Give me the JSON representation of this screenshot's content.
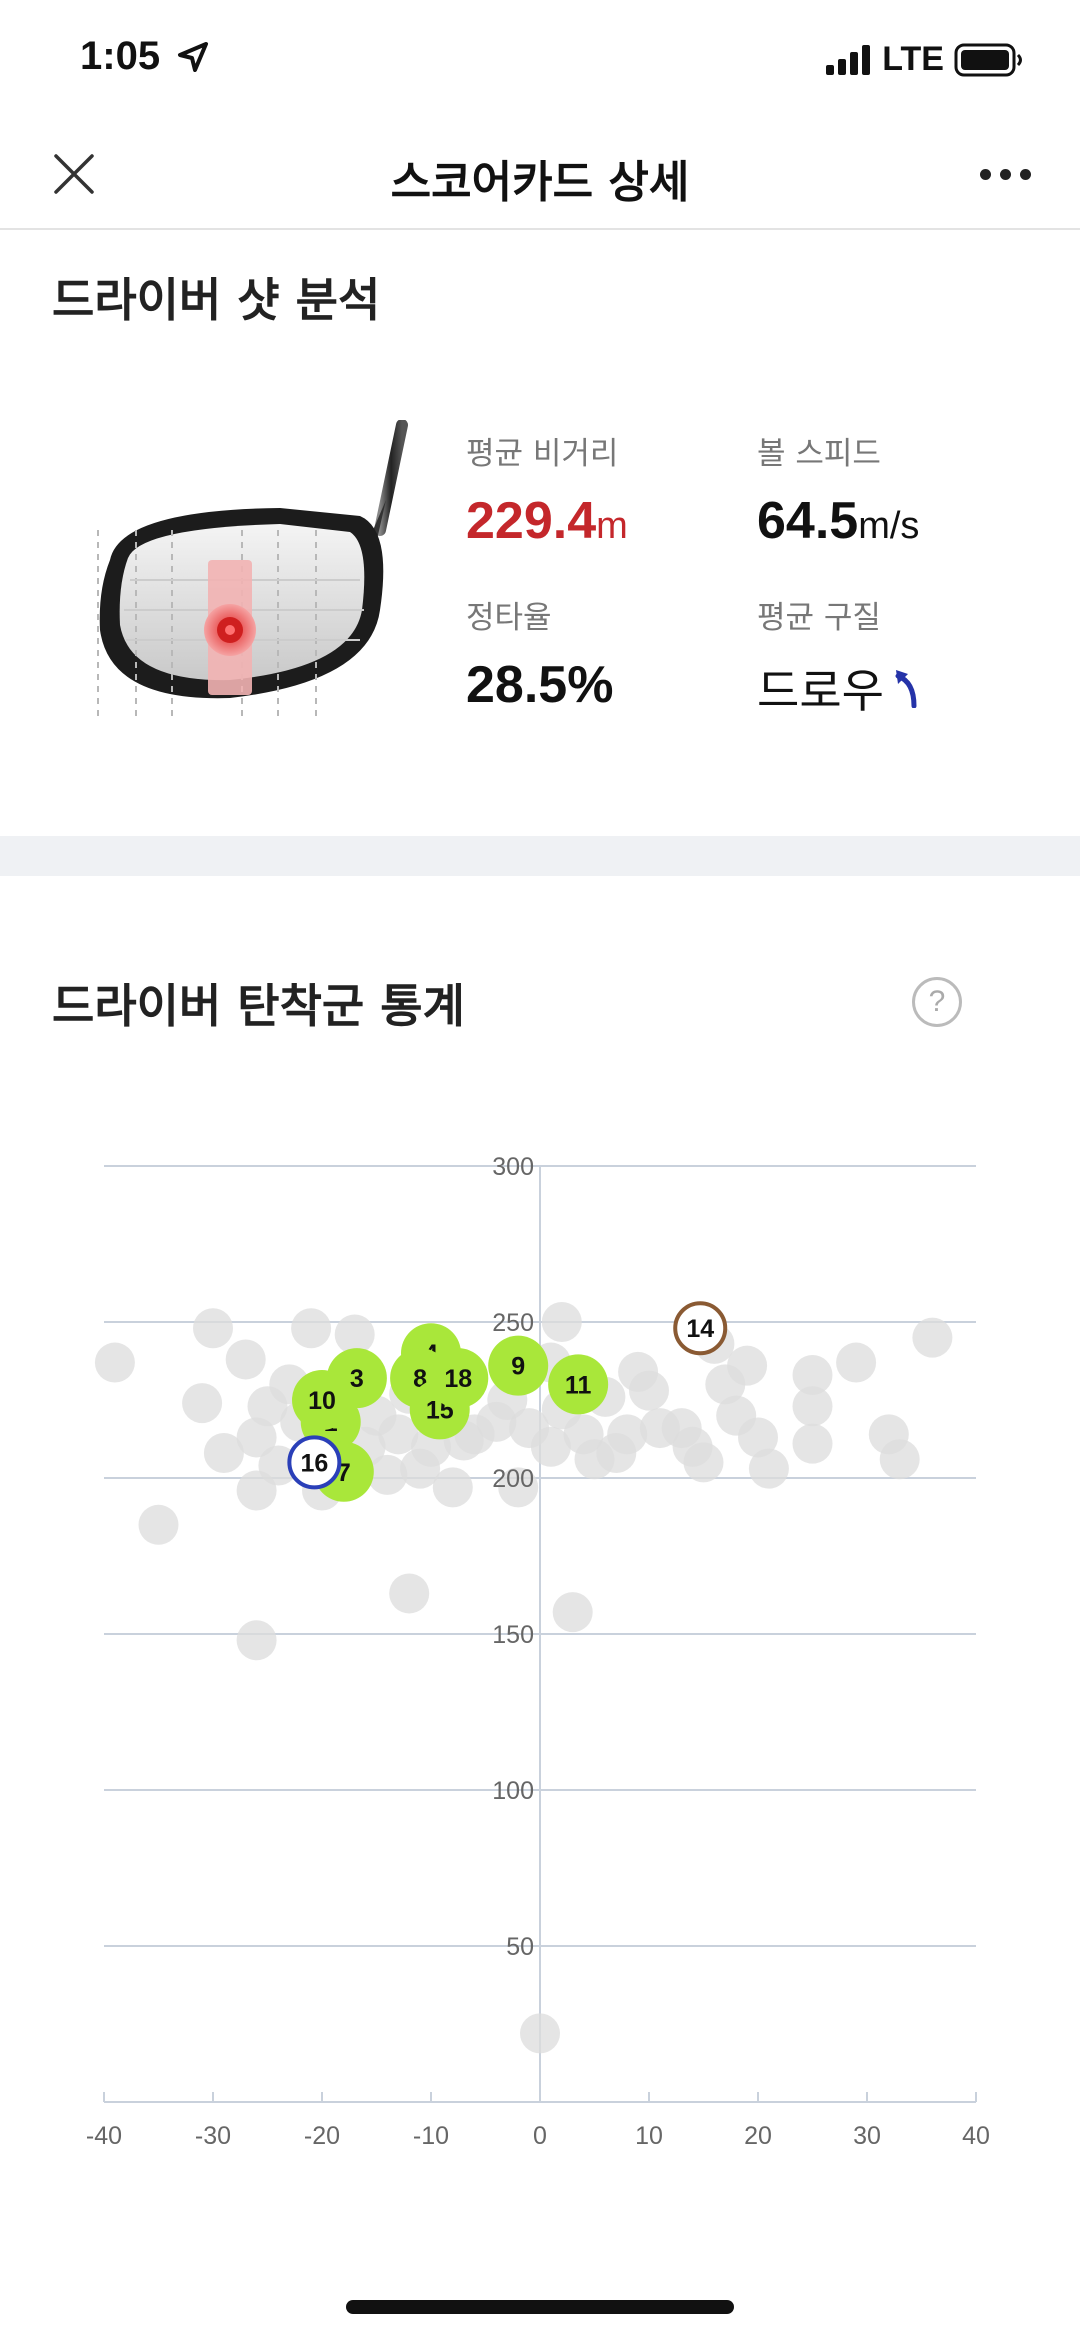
{
  "status": {
    "time": "1:05",
    "network": "LTE"
  },
  "nav": {
    "title": "스코어카드 상세"
  },
  "driver_analysis": {
    "title": "드라이버 샷 분석",
    "avg_distance": {
      "label": "평균 비거리",
      "value": "229.4",
      "unit": "m"
    },
    "ball_speed": {
      "label": "볼 스피드",
      "value": "64.5",
      "unit": "m/s"
    },
    "accuracy": {
      "label": "정타율",
      "value": "28.5%"
    },
    "avg_trajectory": {
      "label": "평균 구질",
      "value": "드로우"
    }
  },
  "landing": {
    "title": "드라이버 탄착군 통계",
    "help_label": "?"
  },
  "colors": {
    "accent_red": "#c4272b",
    "hole_marker": "#a9e73a",
    "history_marker": "#dcdcdc",
    "grid": "#c9d1dc",
    "draw_arrow": "#2533a8",
    "ring_blue": "#2a3fb8",
    "ring_brown": "#8a5a33"
  },
  "chart_data": {
    "type": "scatter",
    "xlim": [
      -40,
      40
    ],
    "ylim": [
      0,
      300
    ],
    "x_ticks": [
      -40,
      -30,
      -20,
      -10,
      0,
      10,
      20,
      30,
      40
    ],
    "y_ticks": [
      50,
      100,
      150,
      200,
      250,
      300
    ],
    "grid": true,
    "series": [
      {
        "points": [
          {
            "label": "1",
            "x": -19.2,
            "y": 218
          },
          {
            "label": "3",
            "x": -16.8,
            "y": 232
          },
          {
            "label": "4",
            "x": -10,
            "y": 240
          },
          {
            "label": "7",
            "x": -18,
            "y": 202
          },
          {
            "label": "8",
            "x": -11,
            "y": 232
          },
          {
            "label": "9",
            "x": -2,
            "y": 236
          },
          {
            "label": "10",
            "x": -20,
            "y": 225
          },
          {
            "label": "11",
            "x": 3.5,
            "y": 230
          },
          {
            "label": "14",
            "x": 14.7,
            "y": 248
          },
          {
            "label": "15",
            "x": -9.2,
            "y": 222
          },
          {
            "label": "16",
            "x": -20.7,
            "y": 205
          },
          {
            "label": "18",
            "x": -7.5,
            "y": 232
          }
        ]
      },
      {
        "points": [
          {
            "x": -39,
            "y": 237
          },
          {
            "x": -35,
            "y": 185
          },
          {
            "x": -30,
            "y": 248
          },
          {
            "x": -31,
            "y": 224
          },
          {
            "x": -29,
            "y": 208
          },
          {
            "x": -27,
            "y": 238
          },
          {
            "x": -26,
            "y": 213
          },
          {
            "x": -26,
            "y": 196
          },
          {
            "x": -26,
            "y": 148
          },
          {
            "x": -25,
            "y": 223
          },
          {
            "x": -24,
            "y": 204
          },
          {
            "x": -23,
            "y": 230
          },
          {
            "x": -22,
            "y": 218
          },
          {
            "x": -21,
            "y": 248
          },
          {
            "x": -20,
            "y": 196
          },
          {
            "x": -17,
            "y": 246
          },
          {
            "x": -16,
            "y": 210
          },
          {
            "x": -15,
            "y": 220
          },
          {
            "x": -14,
            "y": 201
          },
          {
            "x": -13,
            "y": 214
          },
          {
            "x": -12,
            "y": 227
          },
          {
            "x": -12,
            "y": 163
          },
          {
            "x": -11,
            "y": 203
          },
          {
            "x": -10,
            "y": 210
          },
          {
            "x": -8,
            "y": 197
          },
          {
            "x": -7,
            "y": 212
          },
          {
            "x": -4,
            "y": 218
          },
          {
            "x": -3,
            "y": 225
          },
          {
            "x": -2,
            "y": 197
          },
          {
            "x": -1,
            "y": 216
          },
          {
            "x": 1,
            "y": 237
          },
          {
            "x": 1,
            "y": 210
          },
          {
            "x": 2,
            "y": 250
          },
          {
            "x": 2,
            "y": 222
          },
          {
            "x": 3,
            "y": 157
          },
          {
            "x": 4,
            "y": 214
          },
          {
            "x": 5,
            "y": 206
          },
          {
            "x": 7,
            "y": 208
          },
          {
            "x": 8,
            "y": 214
          },
          {
            "x": 9,
            "y": 234
          },
          {
            "x": 10,
            "y": 228
          },
          {
            "x": 11,
            "y": 216
          },
          {
            "x": 13,
            "y": 216
          },
          {
            "x": 14,
            "y": 210
          },
          {
            "x": 15,
            "y": 205
          },
          {
            "x": 17,
            "y": 230
          },
          {
            "x": 18,
            "y": 220
          },
          {
            "x": 19,
            "y": 236
          },
          {
            "x": 20,
            "y": 213
          },
          {
            "x": 21,
            "y": 203
          },
          {
            "x": 25,
            "y": 233
          },
          {
            "x": 25,
            "y": 223
          },
          {
            "x": 25,
            "y": 211
          },
          {
            "x": 29,
            "y": 237
          },
          {
            "x": 32,
            "y": 214
          },
          {
            "x": 33,
            "y": 206
          },
          {
            "x": 36,
            "y": 245
          },
          {
            "x": 0,
            "y": 22
          },
          {
            "x": -18,
            "y": 229
          },
          {
            "x": -6,
            "y": 214
          },
          {
            "x": 6,
            "y": 226
          },
          {
            "x": 16,
            "y": 243
          }
        ]
      }
    ]
  }
}
